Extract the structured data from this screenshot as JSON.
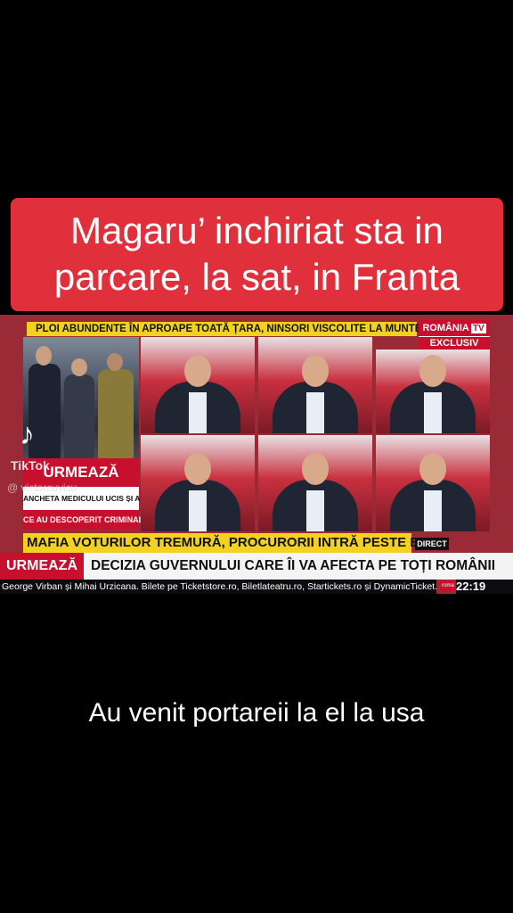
{
  "headline": {
    "line1": "Magaru’ inchiriat sta in",
    "line2": "parcare, la sat, in Franta"
  },
  "broadcast": {
    "top_ticker": "PLOI ABUNDENTE ÎN APROAPE TOATĂ ȚARA, NINSORI VISCOLITE LA MUNTE",
    "channel_name": "ROMÂNIA",
    "channel_tv": "TV",
    "exclusive_badge": "EXCLUSIV",
    "side_panel": {
      "next_label": "URMEAZĂ",
      "story_line1": "ANCHETA MEDICULUI UCIS ȘI ARS",
      "story_line2": "CE AU DESCOPERIT CRIMINALIȘTII"
    },
    "lower_third_headline": "MAFIA VOTURILOR TREMURĂ, PROCURORII INTRĂ PESTE EI",
    "live_badge": "DIRECT",
    "next_label": "URMEAZĂ",
    "next_text": "DECIZIA GUVERNULUI CARE ÎI VA AFECTA PE TOȚI ROMÂNII",
    "crawl_text": "George Virban și Mihai Urzicana. Bilete pe Ticketstore.ro, Biletlateatru.ro, Startickets.ro și DynamicTicket.ro",
    "crawl_logo": "roma",
    "clock": "22:19"
  },
  "tiktok": {
    "brand": "TikTok",
    "username": "@ victorcuvicu"
  },
  "subtitle": "Au venit portareii la el la usa",
  "colors": {
    "headline_bg": "#e0303c",
    "accent_red": "#c8102e",
    "ticker_yellow": "#f2d21f"
  }
}
